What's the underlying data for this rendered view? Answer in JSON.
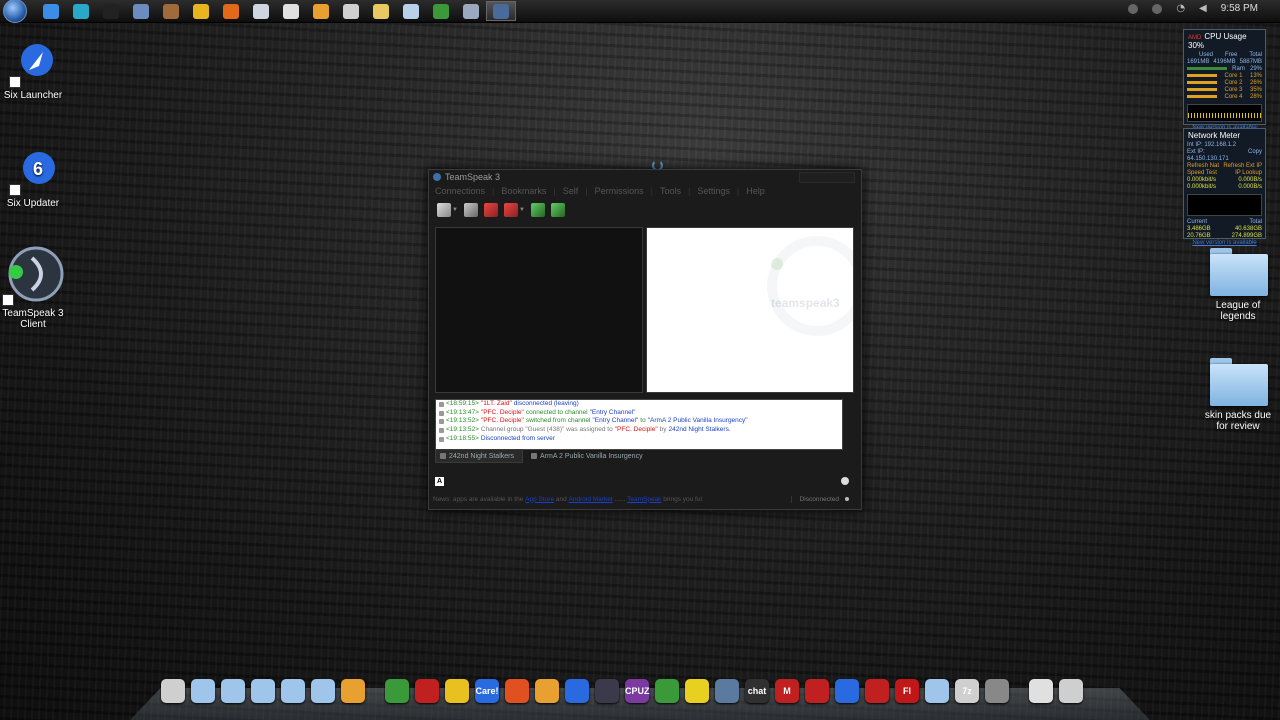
{
  "taskbar": {
    "clock": "9:58 PM",
    "icons": [
      {
        "name": "ie-icon",
        "color": "#3a8ee6"
      },
      {
        "name": "tiles-icon",
        "color": "#2aa8c8"
      },
      {
        "name": "terminal-icon",
        "color": "#222222"
      },
      {
        "name": "monitor-icon",
        "color": "#6c8cc0"
      },
      {
        "name": "tools-icon",
        "color": "#a06a3a"
      },
      {
        "name": "chrome-icon",
        "color": "#e8b420"
      },
      {
        "name": "firefox-icon",
        "color": "#e06a1a"
      },
      {
        "name": "window-icon",
        "color": "#cfd6e0"
      },
      {
        "name": "paper-icon",
        "color": "#e0e0e0"
      },
      {
        "name": "media-icon",
        "color": "#e8a030"
      },
      {
        "name": "document-icon",
        "color": "#cfcfcf"
      },
      {
        "name": "folder-icon",
        "color": "#e8c860"
      },
      {
        "name": "notes-icon",
        "color": "#b8d0ea"
      },
      {
        "name": "excel-icon",
        "color": "#3a9a3a"
      },
      {
        "name": "cube-icon",
        "color": "#9aa8c0"
      },
      {
        "name": "teamspeak-icon",
        "color": "#4a6a9a"
      }
    ]
  },
  "desktop": {
    "icons": [
      {
        "label": "Six Launcher",
        "icon": "rocket-icon",
        "color": "#2a6ae0"
      },
      {
        "label": "Six Updater",
        "icon": "updater-icon",
        "color": "#2a6ae0"
      },
      {
        "label": "TeamSpeak 3 Client",
        "icon": "teamspeak-icon",
        "color": "#5a7aa0"
      }
    ],
    "folders": [
      {
        "label": "League of legends"
      },
      {
        "label": "skin packs due for review"
      }
    ]
  },
  "gadgets": {
    "cpu": {
      "title": "CPU Usage 30%",
      "brand": "AMD",
      "headers": [
        "Used",
        "Free",
        "Total"
      ],
      "mem": [
        "1691MB",
        "4196MB",
        "5887MB"
      ],
      "ram_label": "Ram",
      "ram_value": "29%",
      "cores": [
        {
          "label": "Core 1",
          "value": "13%"
        },
        {
          "label": "Core 2",
          "value": "26%"
        },
        {
          "label": "Core 3",
          "value": "35%"
        },
        {
          "label": "Core 4",
          "value": "28%"
        }
      ],
      "new_version": "New version is available"
    },
    "network": {
      "title": "Network Meter",
      "int_ip": "Int IP: 192.168.1.2",
      "ext_ip": "Ext IP: 64.150.130.171",
      "copy": "Copy",
      "refresh_nat": "Refresh Nat",
      "refresh_ext": "Refresh Ext IP",
      "speed_test": "Speed Test",
      "ip_lookup": "IP Lookup",
      "up1": "0.000kbit/s",
      "up2": "0.000B/s",
      "down1": "0.000kbit/s",
      "down2": "0.000B/s",
      "current": "Current",
      "total": "Total",
      "c_up": "3.486GB",
      "c_down": "20.76GB",
      "t_up": "40.638GB",
      "t_down": "274.899GB",
      "new_version": "New version is available"
    }
  },
  "teamspeak": {
    "title": "TeamSpeak 3",
    "menu": [
      "Connections",
      "Bookmarks",
      "Self",
      "Permissions",
      "Tools",
      "Settings",
      "Help"
    ],
    "watermark": "teamspeak3",
    "log": [
      {
        "time": "<18:59:15>",
        "parts": [
          {
            "t": "\"1LT. Zaid\"",
            "c": "red"
          },
          {
            "t": "disconnected (leaving)",
            "c": "blue"
          }
        ]
      },
      {
        "time": "<19:13:47>",
        "parts": [
          {
            "t": "\"PFC. Deciple\"",
            "c": "red"
          },
          {
            "t": "connected to channel",
            "c": "green"
          },
          {
            "t": "\"Entry Channel\"",
            "c": "blue"
          }
        ]
      },
      {
        "time": "<19:13:52>",
        "parts": [
          {
            "t": "\"PFC. Deciple\"",
            "c": "red"
          },
          {
            "t": "switched from channel",
            "c": "green"
          },
          {
            "t": "\"Entry Channel\"",
            "c": "blue"
          },
          {
            "t": "to",
            "c": "green"
          },
          {
            "t": "\"ArmA 2 Public Vanilla Insurgency\"",
            "c": "blue"
          }
        ]
      },
      {
        "time": "<19:13:52>",
        "parts": [
          {
            "t": "Channel group \"Guest (438)\" was assigned to",
            "c": "grey"
          },
          {
            "t": "\"PFC. Deciple\"",
            "c": "red"
          },
          {
            "t": "by",
            "c": "grey"
          },
          {
            "t": "242nd Night Stalkers.",
            "c": "blue"
          }
        ]
      },
      {
        "time": "<19:18:55>",
        "parts": [
          {
            "t": "Disconnected from server",
            "c": "blue"
          }
        ]
      }
    ],
    "tabs": [
      "242nd Night Stalkers",
      "ArmA 2 Public Vanilla Insurgency"
    ],
    "format_button": "A",
    "status": {
      "news_label": "News:",
      "news_text": "apps are available in the",
      "link1": "App Store",
      "and": "and",
      "link2": "Android Market",
      "dots": "......",
      "link3": "TeamSpeak",
      "brings": "brings you ful",
      "connection": "Disconnected"
    }
  },
  "dock": {
    "items": [
      {
        "name": "alienware-icon",
        "color": "#cfcfcf",
        "text": ""
      },
      {
        "name": "docs-folder-icon",
        "color": "#9fc6ea",
        "text": ""
      },
      {
        "name": "pictures-folder-icon",
        "color": "#9fc6ea",
        "text": ""
      },
      {
        "name": "downloads-folder-icon",
        "color": "#9fc6ea",
        "text": ""
      },
      {
        "name": "music-folder-icon",
        "color": "#9fc6ea",
        "text": ""
      },
      {
        "name": "videos-folder-icon",
        "color": "#9fc6ea",
        "text": ""
      },
      {
        "name": "apps-icon",
        "color": "#e8a030",
        "text": ""
      },
      {
        "name": "spacer",
        "color": "transparent",
        "text": ""
      },
      {
        "name": "chrome-icon",
        "color": "#3a9a3a",
        "text": ""
      },
      {
        "name": "ball-icon",
        "color": "#c02020",
        "text": ""
      },
      {
        "name": "torch-icon",
        "color": "#e8c020",
        "text": ""
      },
      {
        "name": "care-icon",
        "color": "#2a6ae0",
        "text": "Care!"
      },
      {
        "name": "windows-icon",
        "color": "#e05020",
        "text": ""
      },
      {
        "name": "wrench-icon",
        "color": "#e8a030",
        "text": ""
      },
      {
        "name": "six-updater-icon",
        "color": "#2a6ae0",
        "text": ""
      },
      {
        "name": "steam-icon",
        "color": "#3a3a4a",
        "text": ""
      },
      {
        "name": "cpuz-icon",
        "color": "#7a3aa0",
        "text": "CPUZ"
      },
      {
        "name": "xbox-icon",
        "color": "#3a9a3a",
        "text": ""
      },
      {
        "name": "map-icon",
        "color": "#e8d020",
        "text": ""
      },
      {
        "name": "teamspeak-icon",
        "color": "#5a7aa0",
        "text": ""
      },
      {
        "name": "chat-icon",
        "color": "#303030",
        "text": "chat"
      },
      {
        "name": "mcafee-icon",
        "color": "#c02020",
        "text": "M"
      },
      {
        "name": "fraps-icon",
        "color": "#c02020",
        "text": ""
      },
      {
        "name": "star-icon",
        "color": "#2a6ae0",
        "text": ""
      },
      {
        "name": "razer-icon",
        "color": "#c02020",
        "text": ""
      },
      {
        "name": "flash-icon",
        "color": "#c01818",
        "text": "Fl"
      },
      {
        "name": "glass-icon",
        "color": "#9fc6ea",
        "text": ""
      },
      {
        "name": "7zip-icon",
        "color": "#cfcfcf",
        "text": "7z"
      },
      {
        "name": "trash-icon",
        "color": "#888888",
        "text": ""
      },
      {
        "name": "spacer",
        "color": "transparent",
        "text": ""
      },
      {
        "name": "display-icon",
        "color": "#e0e0e0",
        "text": ""
      },
      {
        "name": "screen-icon",
        "color": "#cfcfcf",
        "text": ""
      }
    ]
  }
}
